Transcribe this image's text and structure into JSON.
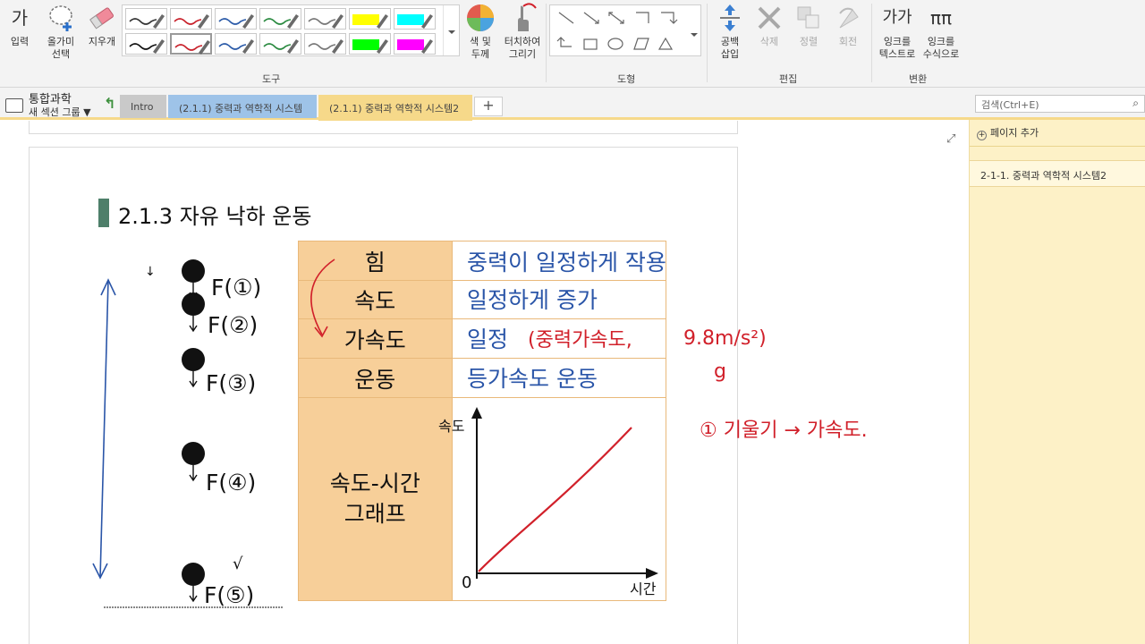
{
  "ribbon": {
    "buttons": {
      "type": "입력",
      "lasso": "올가미\n선택",
      "eraser": "지우개",
      "color_thickness": "색 및\n두께",
      "touch_draw": "터치하여\n그리기",
      "insert_space": "공백\n삽입",
      "delete": "삭제",
      "arrange": "정렬",
      "rotate": "회전",
      "ink_to_text": "잉크를\n텍스트로",
      "ink_to_math": "잉크를\n수식으로"
    },
    "groups": {
      "tools": "도구",
      "shapes": "도형",
      "edit": "편집",
      "convert": "변환"
    },
    "type_icon_text": "가",
    "ink_text_icon": "가가",
    "ink_math_icon": "ππ",
    "pens": [
      {
        "color": "#333333",
        "highlighter": false
      },
      {
        "color": "#c8202a",
        "highlighter": false
      },
      {
        "color": "#2a5aa8",
        "highlighter": false
      },
      {
        "color": "#2a8a40",
        "highlighter": false
      },
      {
        "color": "#777777",
        "highlighter": false
      },
      {
        "color": "#ffff00",
        "highlighter": true
      },
      {
        "color": "#00ffff",
        "highlighter": true
      },
      {
        "color": "#111111",
        "highlighter": false
      },
      {
        "color": "#c8202a",
        "highlighter": false
      },
      {
        "color": "#2a5aa8",
        "highlighter": false
      },
      {
        "color": "#2a8a40",
        "highlighter": false
      },
      {
        "color": "#777777",
        "highlighter": false
      },
      {
        "color": "#00ff00",
        "highlighter": true
      },
      {
        "color": "#ff00ff",
        "highlighter": true
      }
    ]
  },
  "notebook": {
    "title": "통합과학",
    "section_group": "새 섹션 그룹 ▼",
    "back_glyph": "↰"
  },
  "tabs": [
    {
      "label": "Intro",
      "color": "#c9c9c9"
    },
    {
      "label": "(2.1.1) 중력과 역학적 시스템",
      "color": "#9ec3e8"
    },
    {
      "label": "(2.1.1) 중력과 역학적 시스템2",
      "color": "#f6d98a"
    }
  ],
  "tab_add": "+",
  "search": {
    "placeholder": "검색(Ctrl+E)"
  },
  "page": {
    "title": "2.1.3 자유 낙하 운동",
    "table": [
      {
        "label": "힘",
        "value": "중력이 일정하게 작용"
      },
      {
        "label": "속도",
        "value": "일정하게 증가"
      },
      {
        "label": "가속도",
        "value": "일정"
      },
      {
        "label": "운동",
        "value": "등가속도 운동"
      },
      {
        "label": "속도-시간\n그래프",
        "value": ""
      }
    ]
  },
  "graph": {
    "ylabel": "속도",
    "xlabel": "시간",
    "origin": "0"
  },
  "annotations": {
    "accel_note": "(중력가속도,",
    "accel_value": "9.8m/s²)",
    "g_symbol": "g",
    "slope_note": "① 기울기 → 가속도.",
    "check_mark": "√",
    "arrow_small": "↓"
  },
  "force_labels": [
    "F(①)",
    "F(②)",
    "F(③)",
    "F(④)",
    "F(⑤)"
  ],
  "pages_pane": {
    "add_page": "페이지 추가",
    "pages": [
      "2-1-1. 중력과 역학적 시스템2"
    ]
  }
}
